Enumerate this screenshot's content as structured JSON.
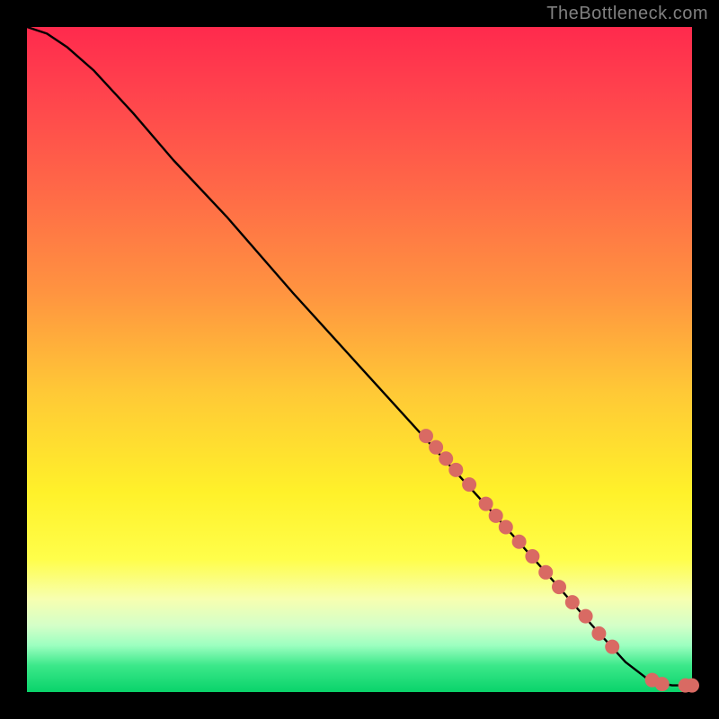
{
  "attribution": "TheBottleneck.com",
  "chart_data": {
    "type": "line",
    "title": "",
    "xlabel": "",
    "ylabel": "",
    "xlim": [
      0,
      100
    ],
    "ylim": [
      0,
      100
    ],
    "grid": false,
    "legend": false,
    "series": [
      {
        "name": "curve",
        "x": [
          0,
          3,
          6,
          10,
          16,
          22,
          30,
          40,
          50,
          60,
          70,
          78,
          85,
          90,
          93,
          95,
          97,
          100
        ],
        "y": [
          100,
          99,
          97,
          93.5,
          87,
          80,
          71.5,
          60,
          49,
          38,
          27,
          18,
          10,
          4.5,
          2.2,
          1.4,
          1.0,
          1.0
        ]
      }
    ],
    "points": [
      {
        "x": 60,
        "y": 38.5
      },
      {
        "x": 61.5,
        "y": 36.8
      },
      {
        "x": 63,
        "y": 35.1
      },
      {
        "x": 64.5,
        "y": 33.4
      },
      {
        "x": 66.5,
        "y": 31.2
      },
      {
        "x": 69,
        "y": 28.3
      },
      {
        "x": 70.5,
        "y": 26.5
      },
      {
        "x": 72,
        "y": 24.8
      },
      {
        "x": 74,
        "y": 22.6
      },
      {
        "x": 76,
        "y": 20.4
      },
      {
        "x": 78,
        "y": 18.0
      },
      {
        "x": 80,
        "y": 15.8
      },
      {
        "x": 82,
        "y": 13.5
      },
      {
        "x": 84,
        "y": 11.4
      },
      {
        "x": 86,
        "y": 8.8
      },
      {
        "x": 88,
        "y": 6.8
      },
      {
        "x": 94,
        "y": 1.8
      },
      {
        "x": 95.5,
        "y": 1.2
      },
      {
        "x": 99,
        "y": 1.0
      },
      {
        "x": 100,
        "y": 1.0
      }
    ],
    "gradient_stops": [
      {
        "offset": 0,
        "color": "#ff2a4d"
      },
      {
        "offset": 10,
        "color": "#ff434d"
      },
      {
        "offset": 25,
        "color": "#ff6a47"
      },
      {
        "offset": 40,
        "color": "#ff9440"
      },
      {
        "offset": 55,
        "color": "#ffc936"
      },
      {
        "offset": 70,
        "color": "#fff12a"
      },
      {
        "offset": 80,
        "color": "#fffe4a"
      },
      {
        "offset": 86,
        "color": "#f7ffb0"
      },
      {
        "offset": 90,
        "color": "#d4ffc8"
      },
      {
        "offset": 93,
        "color": "#9cffc0"
      },
      {
        "offset": 96,
        "color": "#3ce88a"
      },
      {
        "offset": 100,
        "color": "#09d36a"
      }
    ]
  }
}
